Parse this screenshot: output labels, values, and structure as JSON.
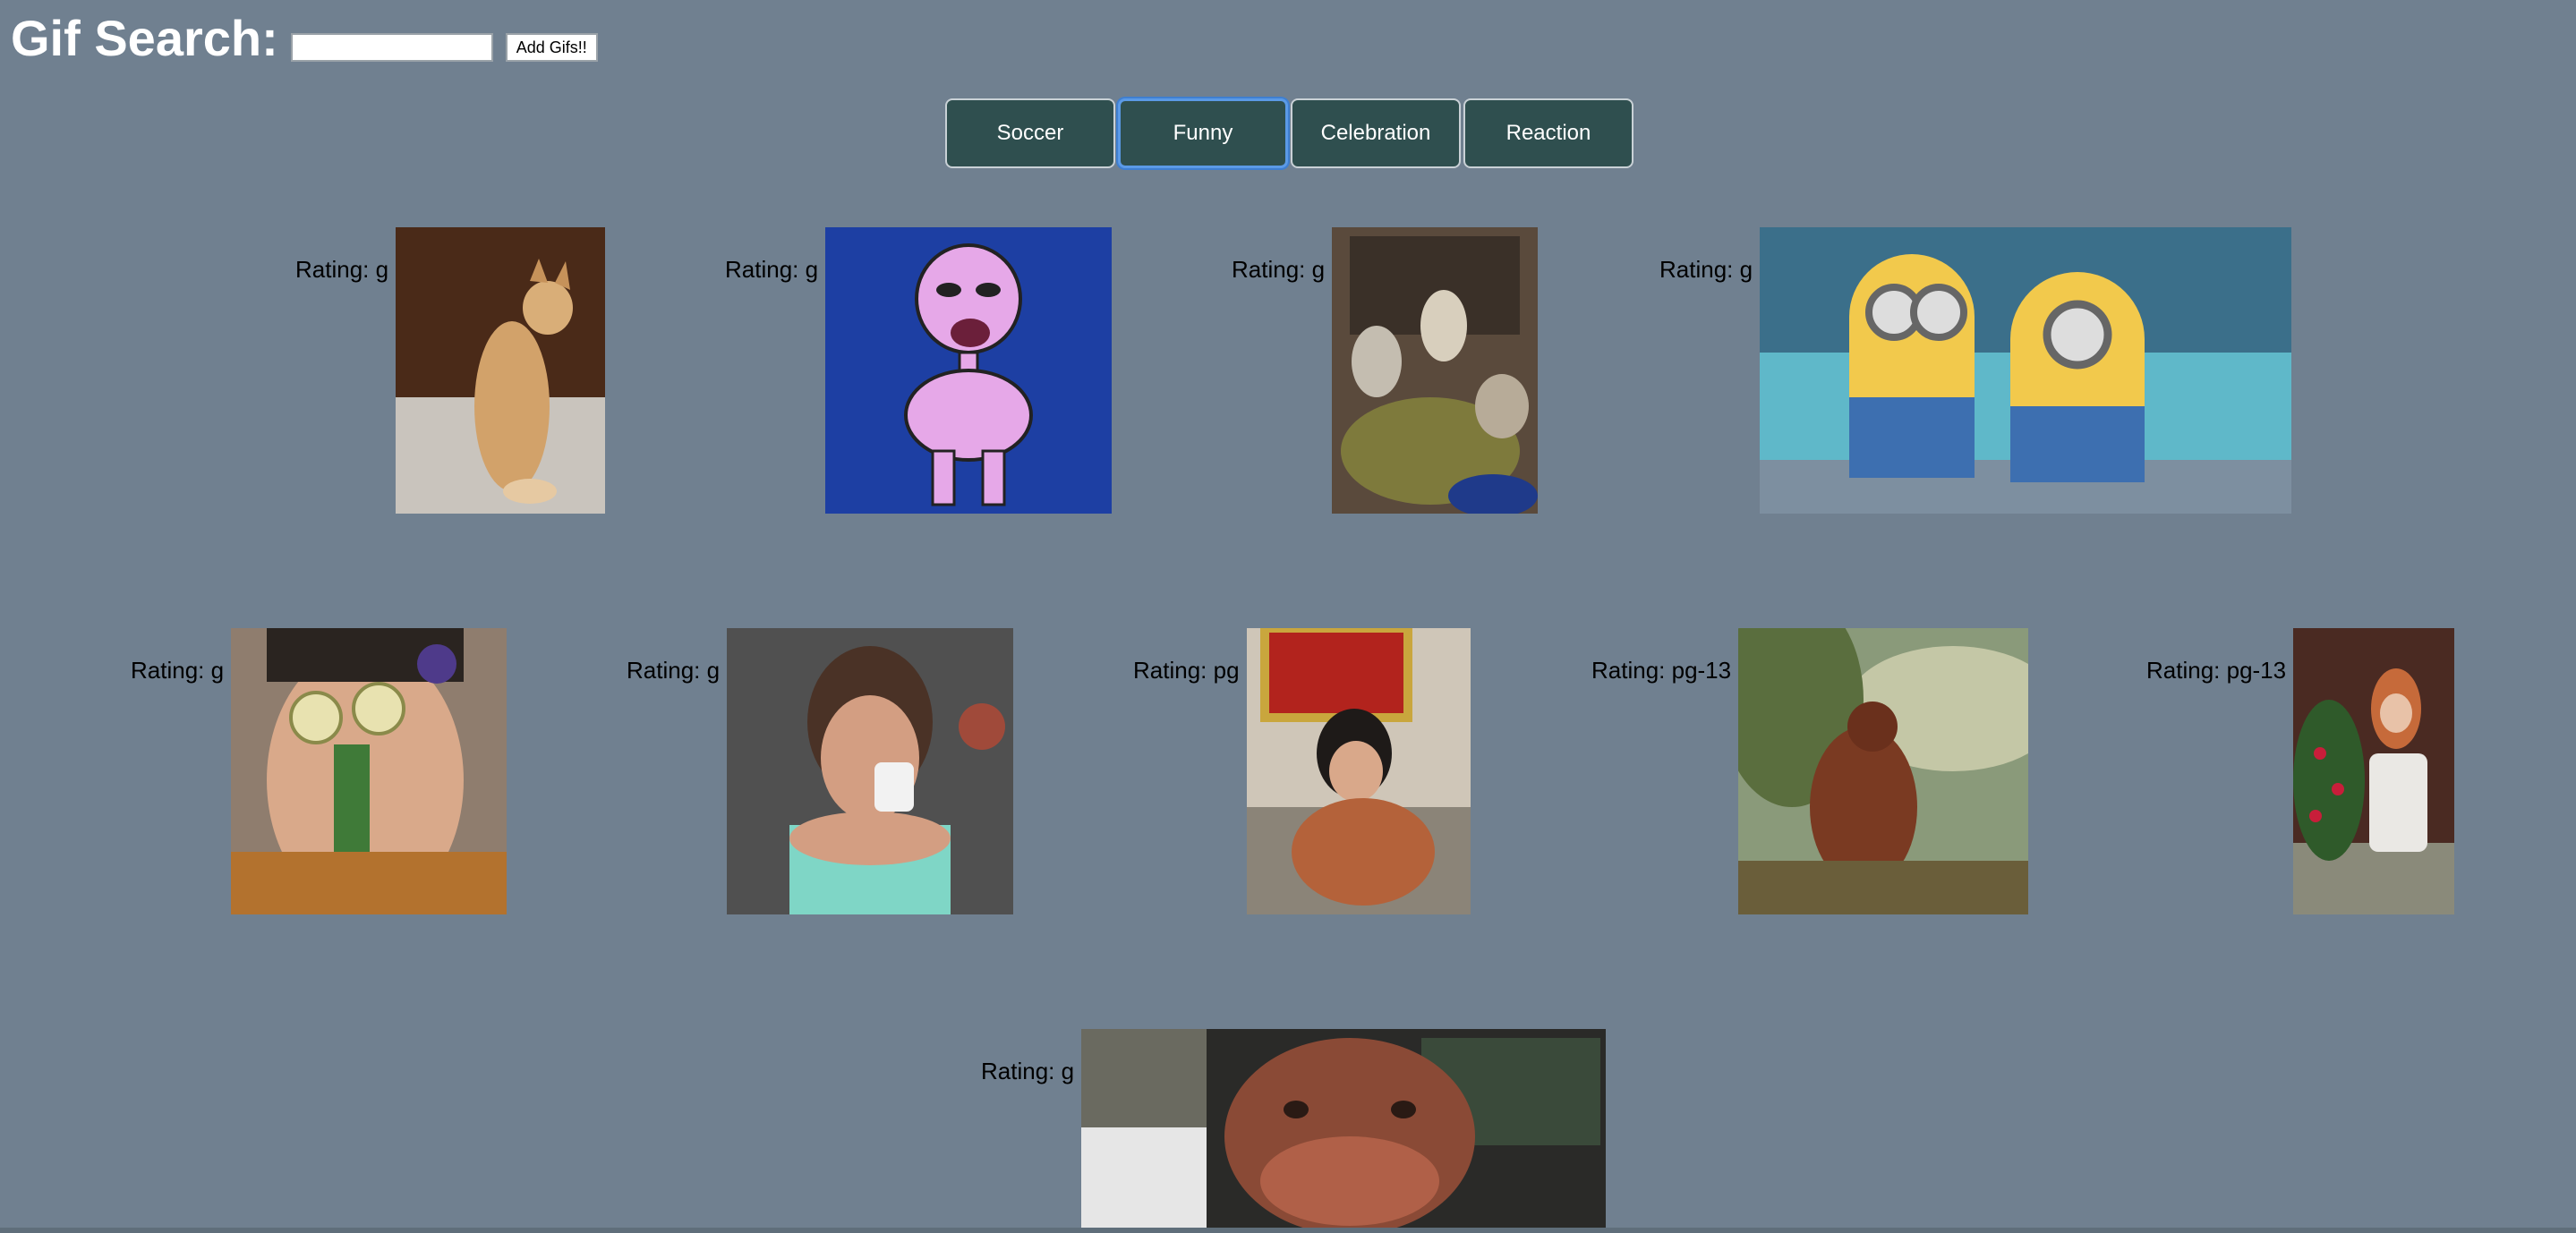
{
  "header": {
    "title": "Gif Search:",
    "search_placeholder": "",
    "search_value": "",
    "add_button_label": "Add Gifs!!"
  },
  "topics": [
    {
      "label": "Soccer",
      "active": false
    },
    {
      "label": "Funny",
      "active": true
    },
    {
      "label": "Celebration",
      "active": false
    },
    {
      "label": "Reaction",
      "active": false
    }
  ],
  "gifs": [
    {
      "rating_label": "Rating: g",
      "content": "orange kitten standing on hind legs"
    },
    {
      "rating_label": "Rating: g",
      "content": "pink cartoon skeleton laughing"
    },
    {
      "rating_label": "Rating: g",
      "content": "llamas in a barn"
    },
    {
      "rating_label": "Rating: g",
      "content": "two minions"
    },
    {
      "rating_label": "Rating: g",
      "content": "person with cucumber slices on eyes and asparagus"
    },
    {
      "rating_label": "Rating: g",
      "content": "woman drinking from a mug"
    },
    {
      "rating_label": "Rating: pg",
      "content": "woman sitting in a room"
    },
    {
      "rating_label": "Rating: pg-13",
      "content": "orangutan dancing"
    },
    {
      "rating_label": "Rating: pg-13",
      "content": "red-haired woman by flowers"
    },
    {
      "rating_label": "Rating: g",
      "content": "dog head out of car window"
    }
  ],
  "colors": {
    "page_background": "#708090",
    "button_background": "#2f4f4f",
    "active_outline": "#5b9ae6"
  }
}
